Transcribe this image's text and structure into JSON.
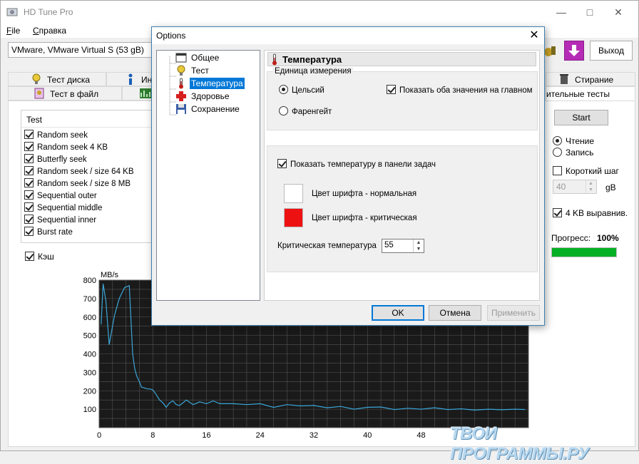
{
  "app": {
    "title": "HD Tune Pro",
    "menu": [
      "File",
      "Справка"
    ],
    "drive": "VMware, VMware Virtual S (53 gB)",
    "exit_label": "Выход",
    "window_controls": [
      "minimize-icon",
      "maximize-icon",
      "close-icon"
    ]
  },
  "tabs": {
    "row1": [
      {
        "label": "Тест диска",
        "icon": "bulb-icon"
      },
      {
        "label": "Ин",
        "icon": "info-icon"
      },
      {
        "label": "Стирание",
        "icon": "trash-icon"
      }
    ],
    "row2": [
      {
        "label": "Тест в файл",
        "icon": "file-bench-icon"
      },
      {
        "label": "",
        "icon": "chart-icon"
      },
      {
        "label": "ительные тесты",
        "icon": ""
      }
    ]
  },
  "tests": {
    "header": "Test",
    "items": [
      {
        "label": "Random seek",
        "checked": true
      },
      {
        "label": "Random seek 4 KB",
        "checked": true
      },
      {
        "label": "Butterfly seek",
        "checked": true
      },
      {
        "label": "Random seek / size 64 KB",
        "checked": true
      },
      {
        "label": "Random seek / size 8 MB",
        "checked": true
      },
      {
        "label": "Sequential outer",
        "checked": true
      },
      {
        "label": "Sequential middle",
        "checked": true
      },
      {
        "label": "Sequential inner",
        "checked": true
      },
      {
        "label": "Burst rate",
        "checked": true
      }
    ],
    "cache_label": "Кэш"
  },
  "right_panel": {
    "start_label": "Start",
    "read_label": "Чтение",
    "write_label": "Запись",
    "short_label": "Короткий шаг",
    "block_value": "40",
    "unit_label": "gB",
    "align_label": "4 KB выравнив.",
    "progress_label": "Прогресс:",
    "progress_text": "100%",
    "progress_value": 1.0,
    "progress_color": "#06b025"
  },
  "options": {
    "title": "Options",
    "nav": [
      {
        "label": "Общее",
        "icon": "general-icon",
        "selected": false
      },
      {
        "label": "Тест",
        "icon": "bulb-icon",
        "selected": false
      },
      {
        "label": "Температура",
        "icon": "thermometer-icon",
        "selected": true
      },
      {
        "label": "Здоровье",
        "icon": "health-cross-icon",
        "selected": false
      },
      {
        "label": "Сохранение",
        "icon": "save-icon",
        "selected": false
      }
    ],
    "panel_title": "Температура",
    "unit_group_label": "Единица измерения",
    "celsius_label": "Цельсий",
    "fahrenheit_label": "Фаренгейт",
    "show_both_label": "Показать оба значения на главном",
    "taskbar_label": "Показать температуру в панели задач",
    "normal_color_label": "Цвет шрифта - нормальная",
    "critical_color_label": "Цвет шрифта - критическая",
    "normal_color": "#ffffff",
    "critical_color": "#ee1111",
    "critical_temp_label": "Критическая температура",
    "critical_temp_value": "55",
    "ok_label": "OK",
    "cancel_label": "Отмена",
    "apply_label": "Применить"
  },
  "chart_data": {
    "type": "line",
    "ylabel": "MB/s",
    "yticks": [
      "800",
      "700",
      "600",
      "500",
      "400",
      "300",
      "200",
      "100"
    ],
    "xticks": [
      "0",
      "8",
      "16",
      "24",
      "32",
      "40",
      "48"
    ],
    "ylim": [
      0,
      800
    ],
    "xlim": [
      0,
      64
    ],
    "grid": true,
    "background": "#1a1a1a",
    "line_color": "#3aa6d8",
    "series": [
      {
        "x": [
          0.3,
          0.6,
          1.0,
          1.5,
          1.8,
          2.3,
          3.0,
          3.8,
          4.5,
          5.0,
          5.3,
          5.6,
          6.0,
          6.3,
          6.8,
          7.2,
          7.6,
          8.0,
          8.5,
          9.0,
          9.5,
          10.0,
          10.5,
          11.0,
          11.5,
          12.0,
          13.0,
          14.0,
          15.0,
          16.0,
          17.0,
          18.0,
          20.0,
          22.0,
          24.0,
          26.0,
          28.0,
          30.0,
          32.0,
          34.0,
          36.0,
          38.0,
          40.0,
          42.0,
          44.0,
          46.0,
          48.0,
          50.0,
          52.0,
          54.0,
          56.0,
          58.0,
          60.0,
          62.0,
          63.5
        ],
        "y": [
          560,
          780,
          690,
          450,
          510,
          610,
          700,
          760,
          770,
          400,
          320,
          280,
          250,
          220,
          215,
          210,
          210,
          205,
          180,
          150,
          135,
          110,
          135,
          145,
          125,
          120,
          150,
          125,
          140,
          130,
          145,
          130,
          130,
          125,
          130,
          110,
          125,
          118,
          120,
          108,
          115,
          100,
          110,
          112,
          98,
          105,
          100,
          108,
          98,
          102,
          95,
          100,
          97,
          100,
          98
        ]
      }
    ]
  },
  "watermark": "ТВОИ ПРОГРАММЫ.РУ"
}
